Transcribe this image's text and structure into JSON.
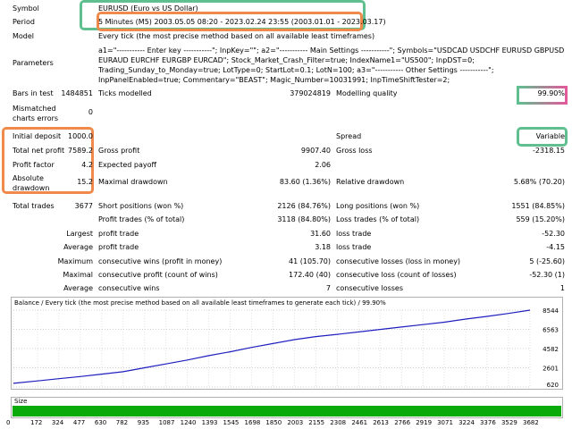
{
  "report": {
    "symbol": {
      "label": "Symbol",
      "value": "EURUSD (Euro vs US Dollar)"
    },
    "period": {
      "label": "Period",
      "value": "5 Minutes (M5) 2003.05.05 08:20 - 2023.02.24 23:55 (2003.01.01 - 2023.03.17)"
    },
    "model": {
      "label": "Model",
      "value": "Every tick (the most precise method based on all available least timeframes)"
    },
    "parameters": {
      "label": "Parameters",
      "value": "a1=\"----------- Enter key -----------\"; InpKey=\"\"; a2=\"----------- Main Settings -----------\"; Symbols=\"USDCAD USDCHF EURUSD GBPUSD EURAUD EURCHF EURGBP EURCAD\"; Stock_Market_Crash_Filter=true; IndexName1=\"US500\"; InpDST=0; Trading_Sunday_to_Monday=true; LotType=0; StartLot=0.1; LotN=100; a3=\"----------- Other Settings -----------\"; InpPanelEnabled=true; Commentary=\"BEAST\"; Magic_Number=10031991; InpTimeShiftTester=2;"
    },
    "bars_in_test": {
      "label": "Bars in test",
      "value": "1484851"
    },
    "ticks_modelled": {
      "label": "Ticks modelled",
      "value": "379024819"
    },
    "modelling_quality": {
      "label": "Modelling quality",
      "value": "99.90%"
    },
    "mismatched": {
      "label": "Mismatched charts errors",
      "value": "0"
    },
    "initial_deposit": {
      "label": "Initial deposit",
      "value": "1000.0"
    },
    "spread": {
      "label": "Spread",
      "value": "Variable"
    },
    "total_net_profit": {
      "label": "Total net profit",
      "value": "7589.2"
    },
    "gross_profit": {
      "label": "Gross profit",
      "value": "9907.40"
    },
    "gross_loss": {
      "label": "Gross loss",
      "value": "-2318.15"
    },
    "profit_factor": {
      "label": "Profit factor",
      "value": "4.2"
    },
    "expected_payoff": {
      "label": "Expected payoff",
      "value": "2.06"
    },
    "absolute_drawdown": {
      "label": "Absolute drawdown",
      "value": "15.2"
    },
    "maximal_drawdown": {
      "label": "Maximal drawdown",
      "value": "83.60 (1.36%)"
    },
    "relative_drawdown": {
      "label": "Relative drawdown",
      "value": "5.68% (70.20)"
    },
    "total_trades": {
      "label": "Total trades",
      "value": "3677"
    },
    "short_positions": {
      "label": "Short positions (won %)",
      "value": "2126 (84.76%)"
    },
    "long_positions": {
      "label": "Long positions (won %)",
      "value": "1551 (84.85%)"
    },
    "profit_trades": {
      "label": "Profit trades (% of total)",
      "value": "3118 (84.80%)"
    },
    "loss_trades": {
      "label": "Loss trades (% of total)",
      "value": "559 (15.20%)"
    },
    "largest": {
      "label": "Largest",
      "profit_label": "profit trade",
      "profit_value": "31.60",
      "loss_label": "loss trade",
      "loss_value": "-52.30"
    },
    "average": {
      "label": "Average",
      "profit_label": "profit trade",
      "profit_value": "3.18",
      "loss_label": "loss trade",
      "loss_value": "-4.15"
    },
    "maximum": {
      "label": "Maximum",
      "wins_label": "consecutive wins (profit in money)",
      "wins_value": "41 (105.70)",
      "losses_label": "consecutive losses (loss in money)",
      "losses_value": "5 (-25.60)"
    },
    "maximal": {
      "label": "Maximal",
      "profit_label": "consecutive profit (count of wins)",
      "profit_value": "172.40 (40)",
      "loss_label": "consecutive loss (count of losses)",
      "loss_value": "-52.30 (1)"
    },
    "average_consec": {
      "label": "Average",
      "wins_label": "consecutive wins",
      "wins_value": "7",
      "losses_label": "consecutive losses",
      "losses_value": "1"
    }
  },
  "chart_data": {
    "type": "line",
    "title": "Balance / Every tick (the most precise method based on all available least timeframes to generate each tick) / 99.90%",
    "x": [
      0,
      172,
      324,
      477,
      630,
      782,
      935,
      1087,
      1240,
      1393,
      1545,
      1698,
      1850,
      2003,
      2155,
      2308,
      2461,
      2613,
      2766,
      2919,
      3071,
      3224,
      3376,
      3529,
      3682
    ],
    "series": [
      {
        "values": [
          1000,
          1250,
          1480,
          1700,
          1950,
          2200,
          2600,
          3000,
          3400,
          3850,
          4250,
          4700,
          5100,
          5500,
          5820,
          6050,
          6300,
          6550,
          6800,
          7050,
          7300,
          7620,
          7900,
          8200,
          8544
        ]
      }
    ],
    "y_ticks": [
      8544,
      6563,
      4582,
      2601,
      620
    ],
    "ylim": [
      620,
      8544
    ],
    "xlim": [
      0,
      3682
    ],
    "line_color": "#1f1fbf",
    "size_panel": {
      "label": "Size",
      "bar_color": "#0aaa0a"
    }
  }
}
